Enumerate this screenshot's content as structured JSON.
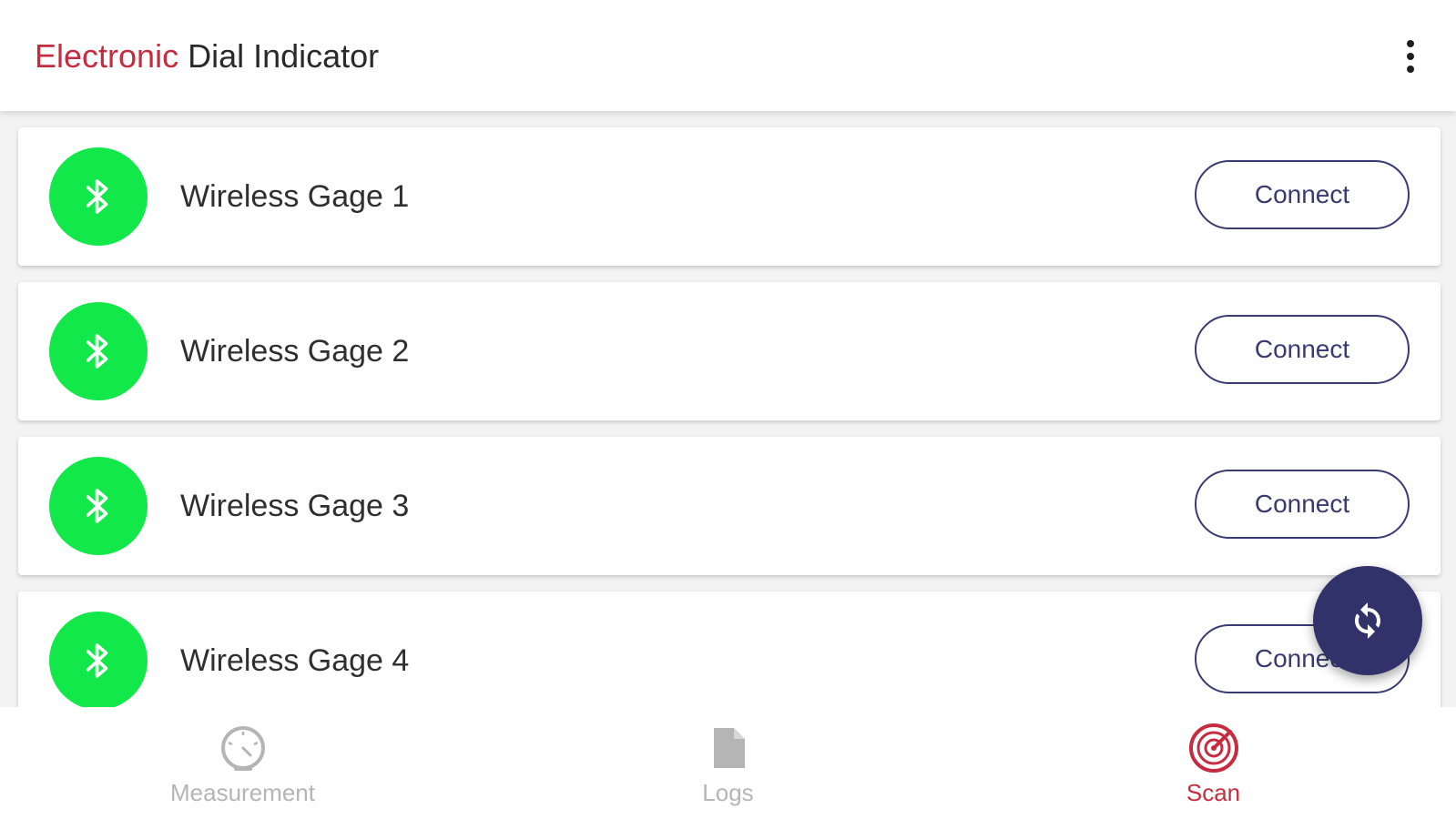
{
  "header": {
    "title_accent": "Electronic",
    "title_rest": "Dial Indicator",
    "menu_icon": "more-vert-icon"
  },
  "devices": [
    {
      "name": "Wireless Gage 1",
      "action": "Connect",
      "icon": "bluetooth-icon"
    },
    {
      "name": "Wireless Gage 2",
      "action": "Connect",
      "icon": "bluetooth-icon"
    },
    {
      "name": "Wireless Gage 3",
      "action": "Connect",
      "icon": "bluetooth-icon"
    },
    {
      "name": "Wireless Gage 4",
      "action": "Connect",
      "icon": "bluetooth-icon"
    }
  ],
  "fab": {
    "icon": "refresh-icon"
  },
  "bottom_nav": {
    "items": [
      {
        "label": "Measurement",
        "icon": "gauge-icon",
        "active": false
      },
      {
        "label": "Logs",
        "icon": "document-icon",
        "active": false
      },
      {
        "label": "Scan",
        "icon": "scan-icon",
        "active": true
      }
    ]
  },
  "colors": {
    "accent": "#c62b3f",
    "bluetooth_green": "#12e84a",
    "primary_navy": "#32326a",
    "inactive_gray": "#b5b5b5"
  }
}
